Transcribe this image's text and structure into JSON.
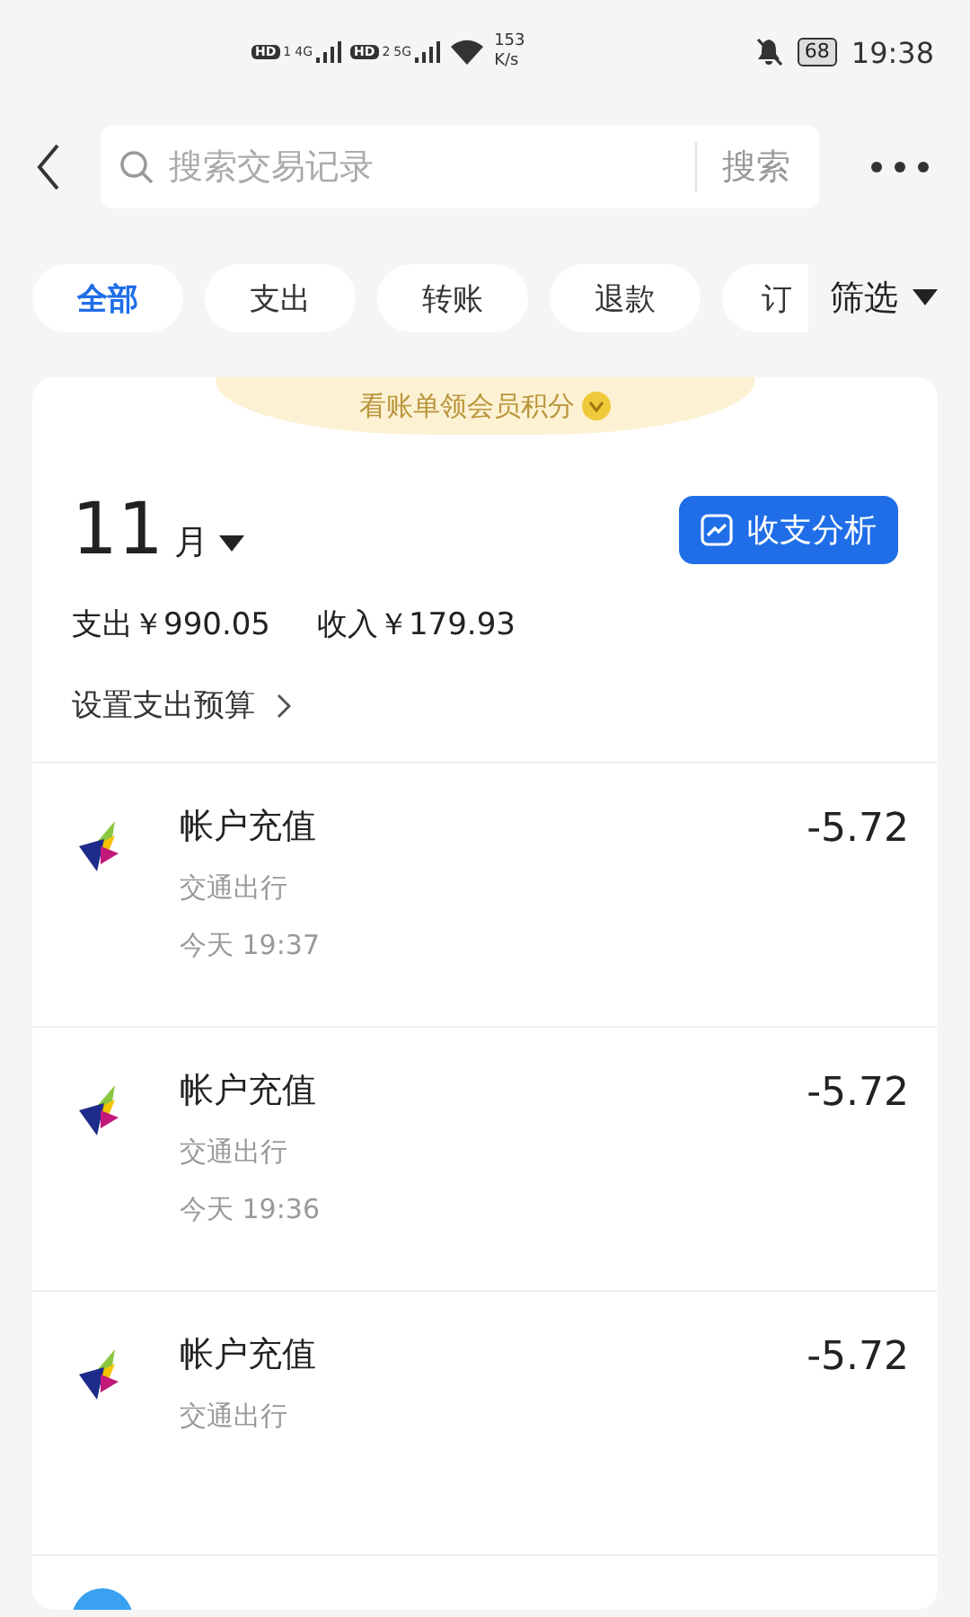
{
  "status_bar": {
    "sim1": {
      "hd": "HD",
      "slot": "1",
      "network": "4G"
    },
    "sim2": {
      "hd": "HD",
      "slot": "2",
      "network": "5G"
    },
    "speed": "153",
    "speed_unit": "K/s",
    "battery": "68",
    "time": "19:38"
  },
  "search": {
    "placeholder": "搜索交易记录",
    "button": "搜索"
  },
  "tabs": [
    {
      "label": "全部",
      "selected": true
    },
    {
      "label": "支出",
      "selected": false
    },
    {
      "label": "转账",
      "selected": false
    },
    {
      "label": "退款",
      "selected": false
    },
    {
      "label": "订",
      "selected": false
    }
  ],
  "filter": "筛选",
  "banner": "看账单领会员积分",
  "summary": {
    "month": "11",
    "month_unit": "月",
    "analysis_button": "收支分析",
    "expense": "支出￥990.05",
    "income": "收入￥179.93",
    "budget_link": "设置支出预算"
  },
  "transactions": [
    {
      "title": "帐户充值",
      "category": "交通出行",
      "time": "今天 19:37",
      "amount": "-5.72"
    },
    {
      "title": "帐户充值",
      "category": "交通出行",
      "time": "今天 19:36",
      "amount": "-5.72"
    },
    {
      "title": "帐户充值",
      "category": "交通出行",
      "amount": "-5.72"
    }
  ]
}
